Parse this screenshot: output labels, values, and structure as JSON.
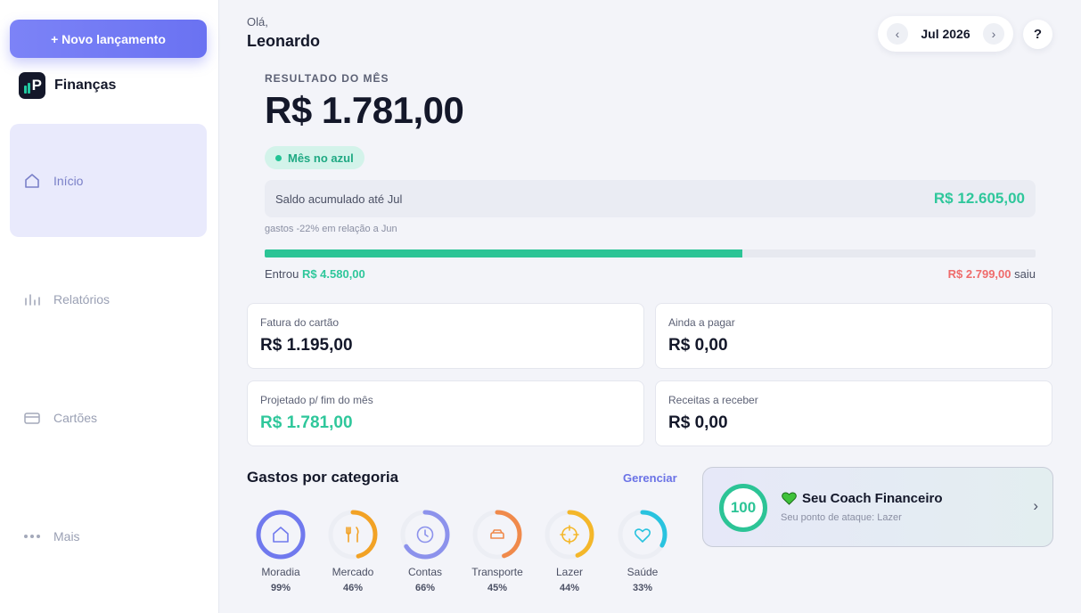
{
  "sidebar": {
    "new_button": "+ Novo lançamento",
    "brand": "Finanças",
    "logo_letter": "P",
    "items": [
      {
        "label": "Início",
        "icon": "home-icon",
        "active": true
      },
      {
        "label": "Relatórios",
        "icon": "bar-chart-icon",
        "active": false
      },
      {
        "label": "Cartões",
        "icon": "card-icon",
        "active": false
      },
      {
        "label": "Mais",
        "icon": "more-icon",
        "active": false
      }
    ]
  },
  "header": {
    "greeting": "Olá,",
    "name": "Leonardo",
    "month": "Jul 2026",
    "prev": "‹",
    "next": "›",
    "help": "?"
  },
  "result": {
    "title": "RESULTADO DO MÊS",
    "value": "R$ 1.781,00",
    "badge": "Mês no azul",
    "saldo_label": "Saldo acumulado até Jul",
    "saldo_value": "R$ 12.605,00",
    "gastos_note": "gastos -22% em relação a Jun",
    "progress": 0.62,
    "entrou_label": "Entrou",
    "entrou_value": "R$ 4.580,00",
    "saiu_value": "R$ 2.799,00",
    "saiu_label": "saiu"
  },
  "cards": [
    {
      "label": "Fatura do cartão",
      "value": "R$ 1.195,00"
    },
    {
      "label": "Ainda a pagar",
      "value": "R$ 0,00"
    },
    {
      "label": "Projetado p/ fim do mês",
      "value": "R$ 1.781,00"
    },
    {
      "label": "Receitas a receber",
      "value": "R$ 0,00"
    }
  ],
  "categories": {
    "title": "Gastos por categoria",
    "manage": "Gerenciar",
    "items": [
      {
        "name": "Moradia",
        "pct": "99%",
        "value": 99,
        "color": "#7079ee",
        "icon": "house-icon"
      },
      {
        "name": "Mercado",
        "pct": "46%",
        "value": 46,
        "color": "#f2a225",
        "icon": "cutlery-icon"
      },
      {
        "name": "Contas",
        "pct": "66%",
        "value": 66,
        "color": "#8c92ec",
        "icon": "clock-icon"
      },
      {
        "name": "Transporte",
        "pct": "45%",
        "value": 45,
        "color": "#f08a4b",
        "icon": "car-icon"
      },
      {
        "name": "Lazer",
        "pct": "44%",
        "value": 44,
        "color": "#f4b72a",
        "icon": "target-icon"
      },
      {
        "name": "Saúde",
        "pct": "33%",
        "value": 33,
        "color": "#29c3df",
        "icon": "heart-icon"
      }
    ]
  },
  "coach": {
    "score": "100",
    "title": "Seu Coach Financeiro",
    "subtitle": "Seu ponto de ataque: Lazer",
    "chevron": "›"
  },
  "colors": {
    "accent": "#6a72f2",
    "positive": "#2fc79b",
    "negative": "#ef6b6b"
  }
}
